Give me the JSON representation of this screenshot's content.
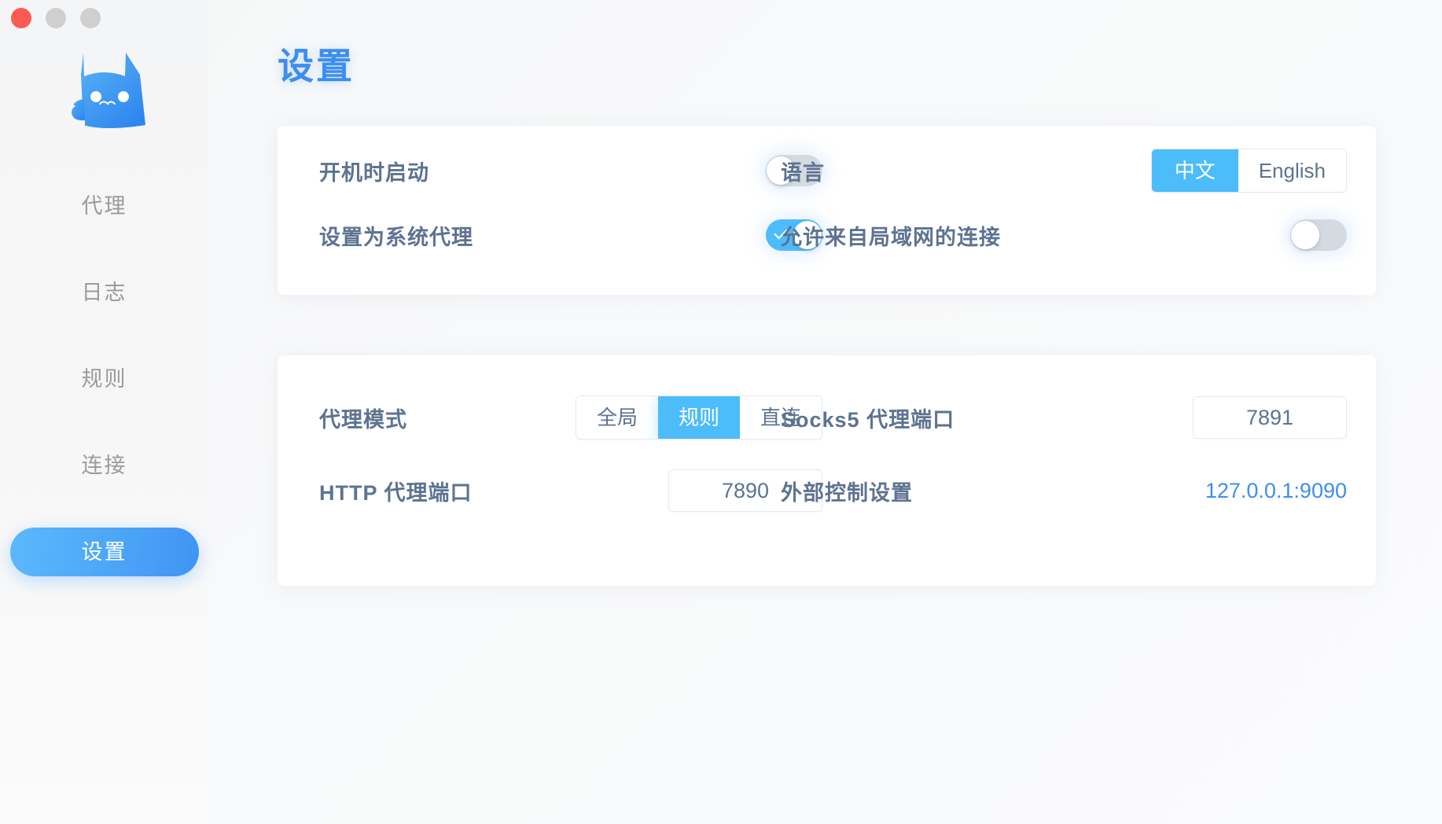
{
  "window": {
    "traffic_lights": [
      {
        "name": "close",
        "color": "#fc5a51"
      },
      {
        "name": "minimize",
        "color": "#cfcfcf"
      },
      {
        "name": "maximize",
        "color": "#cfcfcf"
      }
    ]
  },
  "sidebar": {
    "logo_icon": "cat-logo-icon",
    "items": [
      {
        "label": "代理",
        "active": false
      },
      {
        "label": "日志",
        "active": false
      },
      {
        "label": "规则",
        "active": false
      },
      {
        "label": "连接",
        "active": false
      },
      {
        "label": "设置",
        "active": true
      }
    ]
  },
  "main": {
    "title": "设置",
    "card_general": {
      "startup": {
        "label": "开机时启动",
        "toggle_state": "off"
      },
      "system_proxy": {
        "label": "设置为系统代理",
        "toggle_state": "on"
      },
      "language": {
        "label": "语言",
        "options": [
          "中文",
          "English"
        ],
        "selected": "中文"
      },
      "allow_lan": {
        "label": "允许来自局域网的连接",
        "toggle_state": "off"
      }
    },
    "card_proxy": {
      "proxy_mode": {
        "label": "代理模式",
        "options": [
          "全局",
          "规则",
          "直连"
        ],
        "selected": "规则"
      },
      "socks5_port": {
        "label": "Socks5 代理端口",
        "value": "7891",
        "placeholder": "7891"
      },
      "http_port": {
        "label": "HTTP 代理端口",
        "value": "7890",
        "placeholder": "7890"
      },
      "external_controller": {
        "label": "外部控制设置",
        "value": "127.0.0.1:9090"
      }
    }
  },
  "colors": {
    "accent": "#4cbcfb",
    "accent_dark": "#3c8ef0",
    "label": "#5d7390",
    "nav_inactive": "#9a9a9f",
    "toggle_off": "#d5dae0",
    "card_bg": "#ffffff",
    "app_bg": "#f7f8f9"
  }
}
